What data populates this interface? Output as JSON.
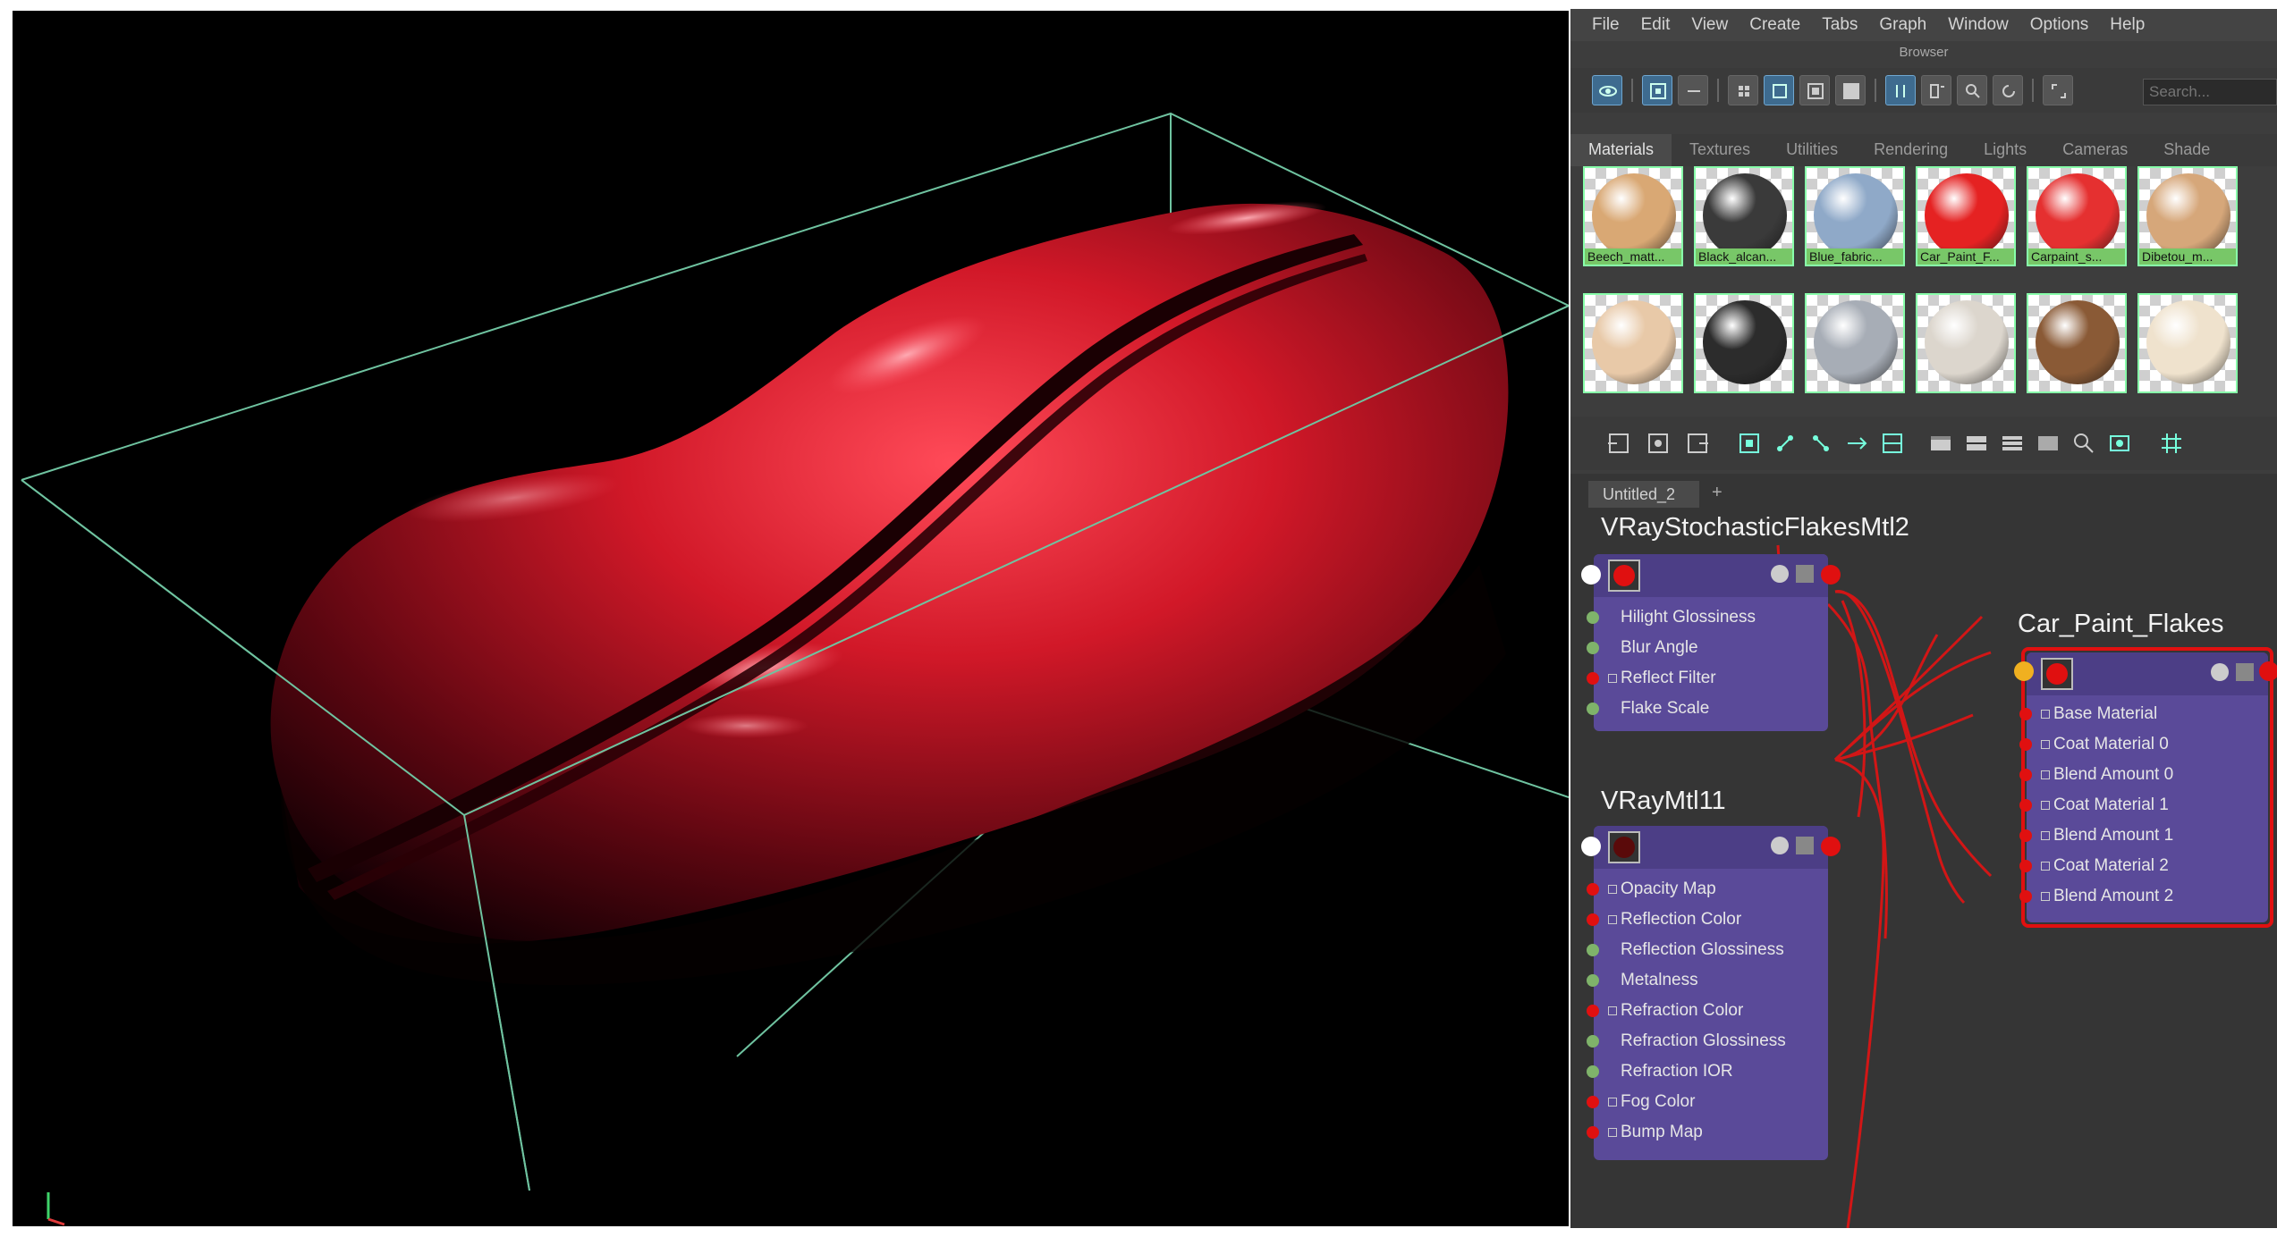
{
  "menu": [
    "File",
    "Edit",
    "View",
    "Create",
    "Tabs",
    "Graph",
    "Window",
    "Options",
    "Help"
  ],
  "browser": {
    "title": "Browser",
    "search_placeholder": "Search...",
    "tabs": [
      "Materials",
      "Textures",
      "Utilities",
      "Rendering",
      "Lights",
      "Cameras",
      "Shade"
    ],
    "swatches": [
      {
        "label": "Beech_matt...",
        "color": "#d9a874"
      },
      {
        "label": "Black_alcan...",
        "color": "#3a3a3a"
      },
      {
        "label": "Blue_fabric...",
        "color": "#8fa9c8"
      },
      {
        "label": "Car_Paint_F...",
        "color": "#e52222"
      },
      {
        "label": "Carpaint_s...",
        "color": "#e53030"
      },
      {
        "label": "Dibetou_m...",
        "color": "#d6a77a"
      },
      {
        "label": "",
        "color": "#e8c9a8"
      },
      {
        "label": "",
        "color": "#2c2c2c"
      },
      {
        "label": "",
        "color": "#a7adb6"
      },
      {
        "label": "",
        "color": "#dcd6cd"
      },
      {
        "label": "",
        "color": "#8a5a36"
      },
      {
        "label": "",
        "color": "#efe2cd"
      }
    ]
  },
  "graph": {
    "tab": "Untitled_2",
    "tab_add": "+",
    "nodes": {
      "flakes": {
        "title": "VRayStochasticFlakesMtl2",
        "attrs": [
          "Hilight Glossiness",
          "Blur Angle",
          "Reflect Filter",
          "Flake Scale"
        ]
      },
      "vraymtl": {
        "title": "VRayMtl11",
        "attrs": [
          "Opacity Map",
          "Reflection Color",
          "Reflection Glossiness",
          "Metalness",
          "Refraction Color",
          "Refraction Glossiness",
          "Refraction IOR",
          "Fog Color",
          "Bump Map"
        ]
      },
      "carpaint": {
        "title": "Car_Paint_Flakes",
        "attrs": [
          "Base Material",
          "Coat Material 0",
          "Blend Amount 0",
          "Coat Material 1",
          "Blend Amount 1",
          "Coat Material 2",
          "Blend Amount 2"
        ]
      }
    }
  },
  "colors": {
    "accent_selected": "#e01010",
    "node_body": "#5a4a99",
    "pin_red": "#e01010",
    "pin_green": "#7fb36a",
    "bbox_green": "#6fc3a0",
    "car_red": "#e8283a"
  }
}
